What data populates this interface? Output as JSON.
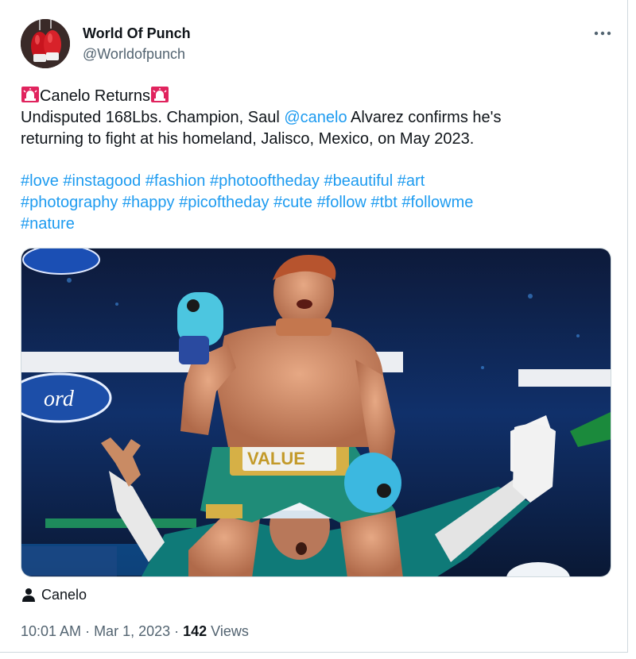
{
  "author": {
    "name": "World Of Punch",
    "handle": "@Worldofpunch",
    "avatar_icon": "boxing-gloves-avatar"
  },
  "tweet": {
    "title": "Canelo Returns",
    "line1_prefix": "Undisputed 168Lbs. Champion, Saul ",
    "mention": "@canelo",
    "line1_suffix": " Alvarez confirms he's",
    "line2": "returning to fight at his homeland, Jalisco, Mexico, on May 2023.",
    "hashtags_line1": [
      "#love",
      "#instagood",
      "#fashion",
      "#photooftheday",
      "#beautiful",
      "#art"
    ],
    "hashtags_line2": [
      "#photography",
      "#happy",
      "#picoftheday",
      "#cute",
      "#follow",
      "#tbt",
      "#followme"
    ],
    "hashtags_line3": [
      "#nature"
    ]
  },
  "media": {
    "banner_text": "VALUE",
    "glove_text": "Ford"
  },
  "tagged": {
    "label": "Canelo"
  },
  "meta": {
    "time": "10:01 AM",
    "separator": " · ",
    "date": "Mar 1, 2023",
    "views_count": "142",
    "views_label": " Views"
  },
  "colors": {
    "link": "#1d9bf0",
    "secondary_text": "#536471",
    "siren_red": "#e0245e"
  }
}
